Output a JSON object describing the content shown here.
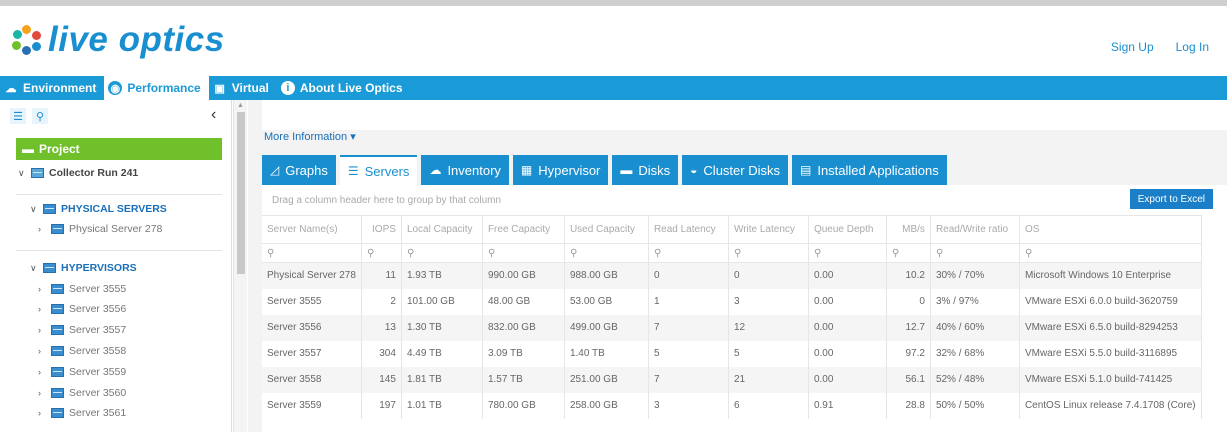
{
  "brand": {
    "name": "live optics",
    "colors": {
      "primary": "#1a9ad6",
      "green": "#6fc02a",
      "text": "#555555"
    }
  },
  "top_links": {
    "sign_up": "Sign Up",
    "log_in": "Log In"
  },
  "nav": {
    "items": [
      {
        "label": "Environment",
        "icon": "cloud-icon",
        "active": false
      },
      {
        "label": "Performance",
        "icon": "performance-icon",
        "active": true
      },
      {
        "label": "Virtual",
        "icon": "virtual-icon",
        "active": false
      },
      {
        "label": "About Live Optics",
        "icon": "info-icon",
        "active": false
      }
    ]
  },
  "sidebar": {
    "project_label": "Project",
    "collector": "Collector Run 241",
    "physical_header": "PHYSICAL SERVERS",
    "physical_items": [
      "Physical Server 278"
    ],
    "hypervisors_header": "HYPERVISORS",
    "hypervisor_items": [
      "Server 3555",
      "Server 3556",
      "Server 3557",
      "Server 3558",
      "Server 3559",
      "Server 3560",
      "Server 3561"
    ]
  },
  "main": {
    "more_information": "More Information",
    "tabs": [
      {
        "label": "Graphs",
        "icon": "graph-icon"
      },
      {
        "label": "Servers",
        "icon": "servers-icon"
      },
      {
        "label": "Inventory",
        "icon": "inventory-icon"
      },
      {
        "label": "Hypervisor",
        "icon": "hypervisor-icon"
      },
      {
        "label": "Disks",
        "icon": "disks-icon"
      },
      {
        "label": "Cluster Disks",
        "icon": "cluster-disks-icon"
      },
      {
        "label": "Installed Applications",
        "icon": "applications-icon"
      }
    ],
    "active_tab": "Servers",
    "group_hint": "Drag a column header here to group by that column",
    "export_label": "Export to Excel",
    "columns": [
      "Server Name(s)",
      "IOPS",
      "Local Capacity",
      "Free Capacity",
      "Used Capacity",
      "Read Latency",
      "Write Latency",
      "Queue Depth",
      "MB/s",
      "Read/Write ratio",
      "OS"
    ],
    "rows": [
      [
        "Physical Server 278",
        "11",
        "1.93 TB",
        "990.00 GB",
        "988.00 GB",
        "0",
        "0",
        "0.00",
        "10.2",
        "30% / 70%",
        "Microsoft Windows 10 Enterprise"
      ],
      [
        "Server 3555",
        "2",
        "101.00 GB",
        "48.00 GB",
        "53.00 GB",
        "1",
        "3",
        "0.00",
        "0",
        "3% / 97%",
        "VMware ESXi 6.0.0 build-3620759"
      ],
      [
        "Server 3556",
        "13",
        "1.30 TB",
        "832.00 GB",
        "499.00 GB",
        "7",
        "12",
        "0.00",
        "12.7",
        "40% / 60%",
        "VMware ESXi 6.5.0 build-8294253"
      ],
      [
        "Server 3557",
        "304",
        "4.49 TB",
        "3.09 TB",
        "1.40 TB",
        "5",
        "5",
        "0.00",
        "97.2",
        "32% / 68%",
        "VMware ESXi 5.5.0 build-3116895"
      ],
      [
        "Server 3558",
        "145",
        "1.81 TB",
        "1.57 TB",
        "251.00 GB",
        "7",
        "21",
        "0.00",
        "56.1",
        "52% / 48%",
        "VMware ESXi 5.1.0 build-741425"
      ],
      [
        "Server 3559",
        "197",
        "1.01 TB",
        "780.00 GB",
        "258.00 GB",
        "3",
        "6",
        "0.91",
        "28.8",
        "50% / 50%",
        "CentOS Linux release 7.4.1708 (Core)"
      ]
    ]
  }
}
